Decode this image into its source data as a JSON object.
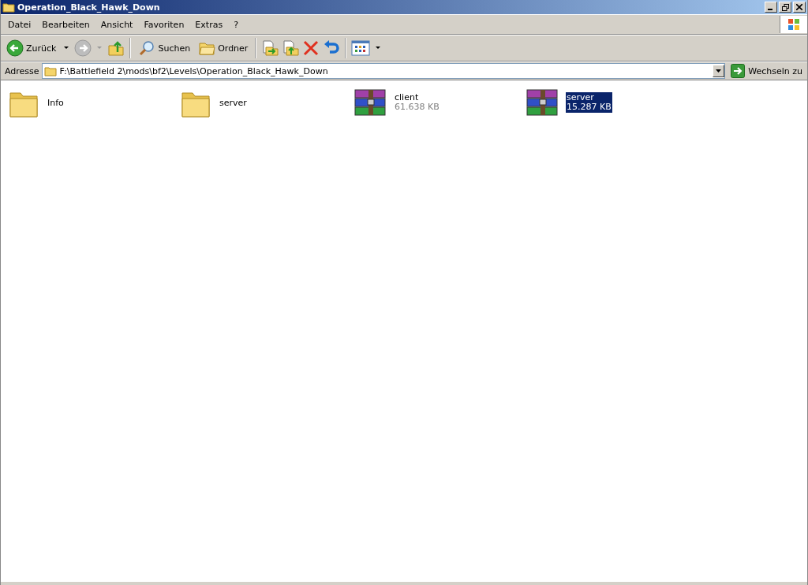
{
  "window": {
    "title": "Operation_Black_Hawk_Down"
  },
  "menu": [
    "Datei",
    "Bearbeiten",
    "Ansicht",
    "Favoriten",
    "Extras",
    "?"
  ],
  "toolbar": {
    "back": "Zurück",
    "search": "Suchen",
    "folders": "Ordner"
  },
  "address": {
    "label": "Adresse",
    "value": "F:\\Battlefield 2\\mods\\bf2\\Levels\\Operation_Black_Hawk_Down",
    "go": "Wechseln zu"
  },
  "items": [
    {
      "kind": "folder",
      "name": "Info",
      "selected": false
    },
    {
      "kind": "folder",
      "name": "server",
      "selected": false
    },
    {
      "kind": "archive",
      "name": "client",
      "size": "61.638 KB",
      "selected": false
    },
    {
      "kind": "archive",
      "name": "server",
      "size": "15.287 KB",
      "selected": true
    }
  ]
}
